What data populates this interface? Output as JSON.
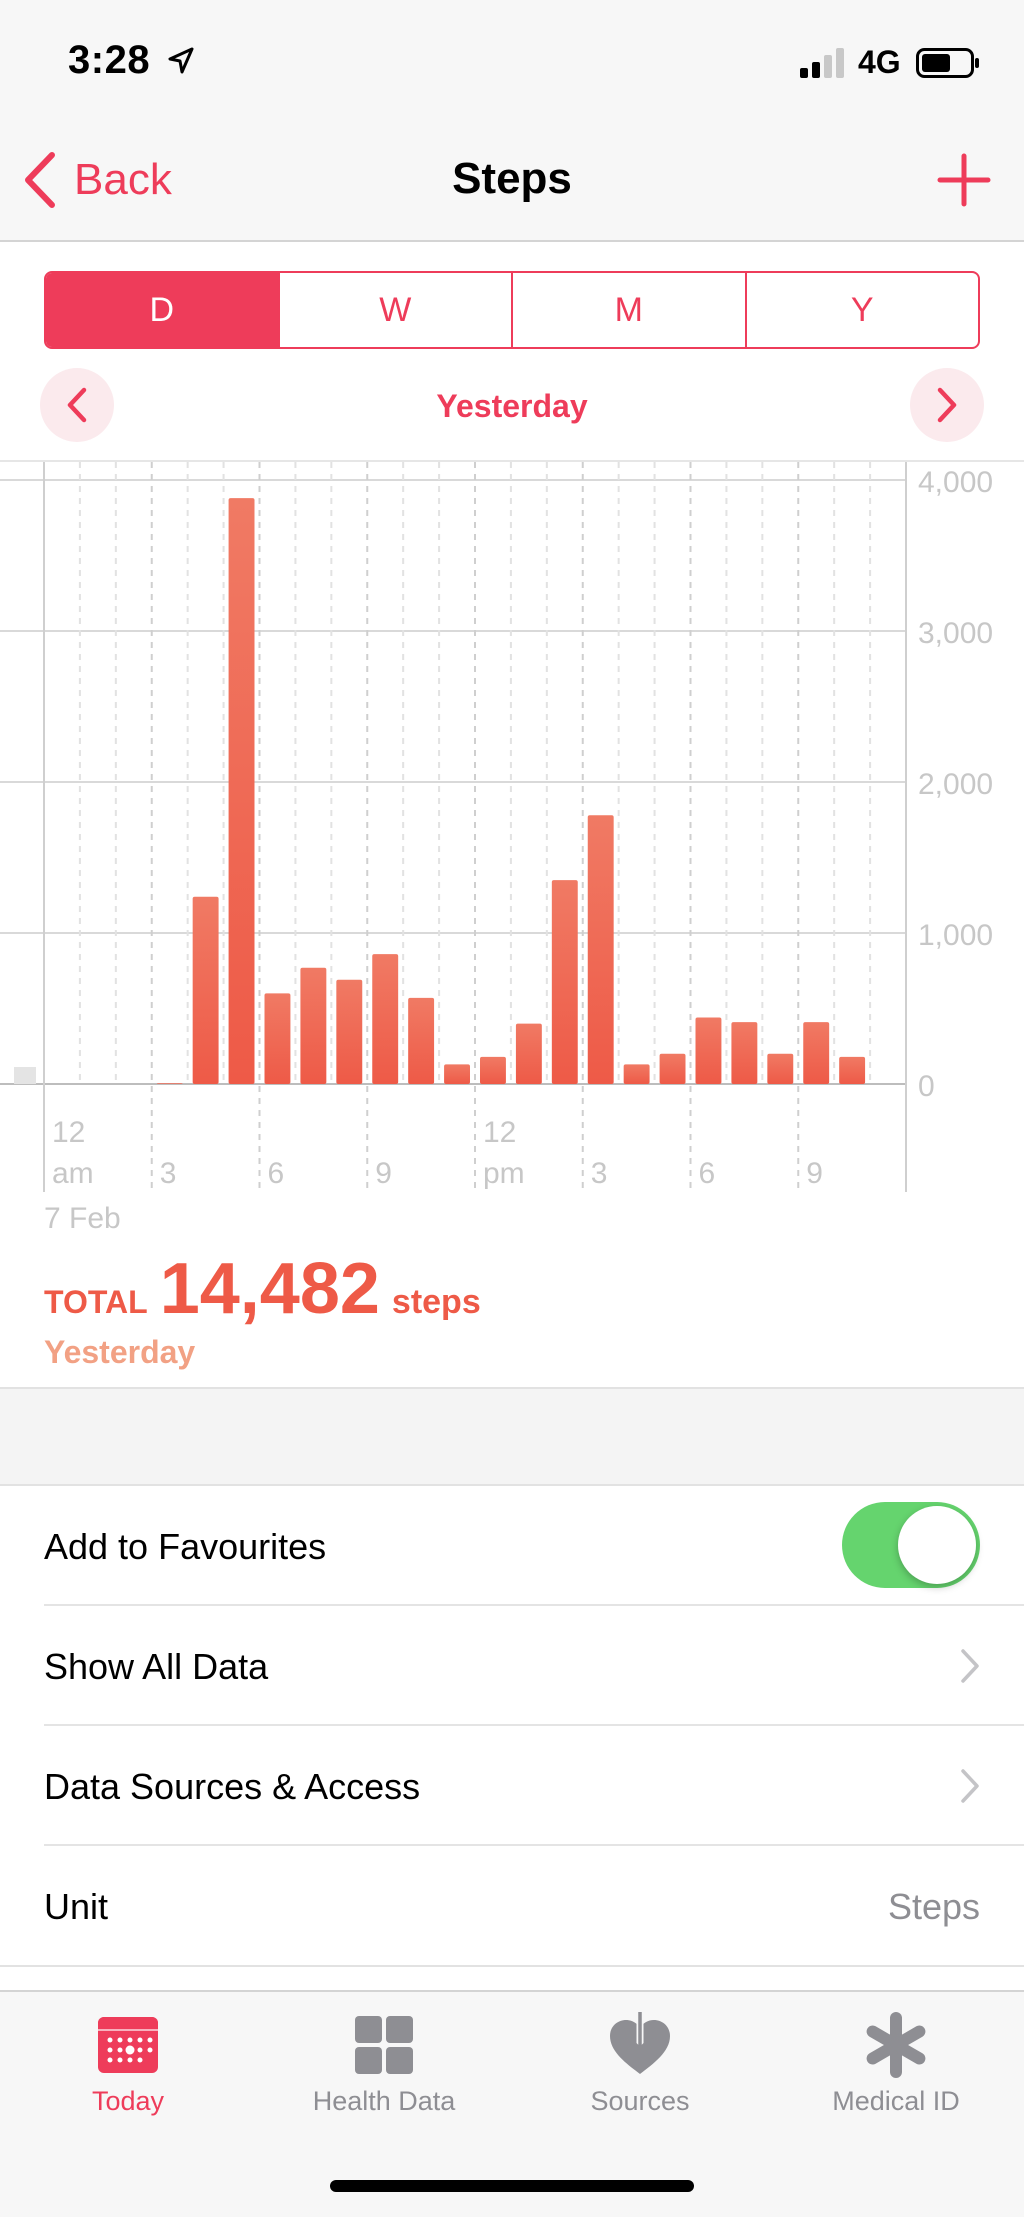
{
  "status": {
    "time": "3:28",
    "network": "4G"
  },
  "nav": {
    "back_label": "Back",
    "title": "Steps"
  },
  "segments": [
    {
      "label": "D",
      "active": true
    },
    {
      "label": "W",
      "active": false
    },
    {
      "label": "M",
      "active": false
    },
    {
      "label": "Y",
      "active": false
    }
  ],
  "date_nav": {
    "label": "Yesterday"
  },
  "chart_data": {
    "type": "bar",
    "x_tick_labels": [
      {
        "line1": "12",
        "line2": "am",
        "hour": 0
      },
      {
        "line1": "",
        "line2": "3",
        "hour": 3
      },
      {
        "line1": "",
        "line2": "6",
        "hour": 6
      },
      {
        "line1": "",
        "line2": "9",
        "hour": 9
      },
      {
        "line1": "12",
        "line2": "pm",
        "hour": 12
      },
      {
        "line1": "",
        "line2": "3",
        "hour": 15
      },
      {
        "line1": "",
        "line2": "6",
        "hour": 18
      },
      {
        "line1": "",
        "line2": "9",
        "hour": 21
      }
    ],
    "date_label": "7 Feb",
    "y_ticks": [
      "4,000",
      "3,000",
      "2,000",
      "1,000",
      "0"
    ],
    "y_tick_values": [
      4000,
      3000,
      2000,
      1000,
      0
    ],
    "ylim": [
      0,
      4000
    ],
    "hours": [
      0,
      1,
      2,
      3,
      4,
      5,
      6,
      7,
      8,
      9,
      10,
      11,
      12,
      13,
      14,
      15,
      16,
      17,
      18,
      19,
      20,
      21,
      22,
      23
    ],
    "values": [
      0,
      0,
      0,
      5,
      1240,
      3880,
      600,
      770,
      690,
      860,
      570,
      130,
      180,
      400,
      1350,
      1780,
      130,
      200,
      440,
      410,
      200,
      410,
      180,
      0
    ],
    "bar_color": "#ee5a47",
    "grid": true
  },
  "total": {
    "word": "TOTAL",
    "value": "14,482",
    "unit": "steps",
    "period": "Yesterday"
  },
  "settings": {
    "favourites_label": "Add to Favourites",
    "favourites_on": true,
    "show_all_label": "Show All Data",
    "sources_label": "Data Sources & Access",
    "unit_label": "Unit",
    "unit_value": "Steps"
  },
  "tabs": [
    {
      "label": "Today",
      "icon": "calendar-icon",
      "active": true
    },
    {
      "label": "Health Data",
      "icon": "grid-icon",
      "active": false
    },
    {
      "label": "Sources",
      "icon": "heart-download-icon",
      "active": false
    },
    {
      "label": "Medical ID",
      "icon": "asterisk-icon",
      "active": false
    }
  ],
  "colors": {
    "accent": "#ee3c5a",
    "bar": "#ee5a47",
    "toggle_on": "#65d46e"
  }
}
